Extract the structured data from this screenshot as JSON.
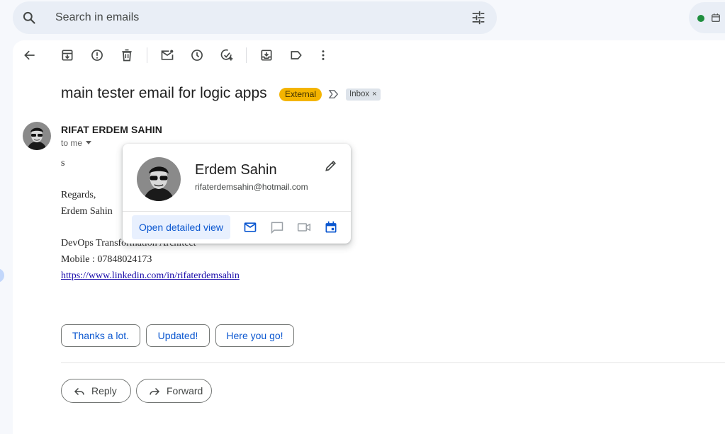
{
  "search": {
    "placeholder": "Search in emails",
    "icon": "search-icon",
    "filter_icon": "tune-icon"
  },
  "status": {
    "dot_color": "#1e8e3e",
    "icon": "calendar-icon"
  },
  "toolbar": {
    "icons": [
      "back-arrow-icon",
      "archive-icon",
      "report-spam-icon",
      "delete-icon",
      "mark-unread-icon",
      "snooze-icon",
      "add-to-tasks-icon",
      "move-to-icon",
      "label-icon",
      "more-vert-icon"
    ]
  },
  "email": {
    "subject": "main tester email for logic apps",
    "badges": {
      "external": "External",
      "inbox": "Inbox",
      "inbox_close": "×"
    },
    "sender": "RIFAT ERDEM SAHIN",
    "recipient": "to me",
    "body": {
      "line1": "s",
      "regards": "Regards,",
      "name": "Erdem Sahin",
      "title": "DevOps Transformation Architect",
      "mobile": "Mobile : 07848024173",
      "link": "https://www.linkedin.com/in/rifaterdemsahin"
    },
    "smart_replies": [
      "Thanks a lot.",
      "Updated!",
      "Here you go!"
    ],
    "reply_label": "Reply",
    "forward_label": "Forward"
  },
  "contact_card": {
    "name": "Erdem Sahin",
    "email": "rifaterdemsahin@hotmail.com",
    "open_detailed_view": "Open detailed view",
    "icons": [
      "email-icon",
      "chat-icon",
      "video-icon",
      "calendar-icon"
    ]
  },
  "colors": {
    "accent": "#0b57d0",
    "external_badge": "#f4b400",
    "link": "#1a0dab"
  }
}
